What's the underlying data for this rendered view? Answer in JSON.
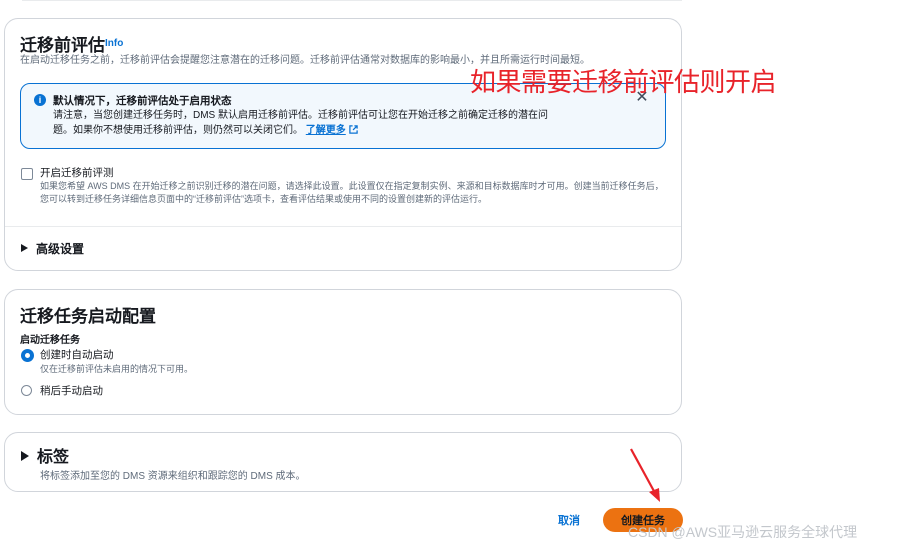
{
  "premigration": {
    "title": "迁移前评估",
    "info_link": "Info",
    "description": "在启动迁移任务之前，迁移前评估会提醒您注意潜在的迁移问题。迁移前评估通常对数据库的影响最小，并且所需运行时间最短。",
    "alert": {
      "title": "默认情况下，迁移前评估处于启用状态",
      "body_line1": "请注意，当您创建迁移任务时，DMS 默认启用迁移前评估。迁移前评估可让您在开始迁移之前确定迁移的潜在问",
      "body_line2": "题。如果你不想使用迁移前评估，则仍然可以关闭它们。",
      "learn_more": "了解更多"
    },
    "checkbox_label": "开启迁移前评测",
    "checkbox_desc": "如果您希望 AWS DMS 在开始迁移之前识别迁移的潜在问题，请选择此设置。此设置仅在指定复制实例、来源和目标数据库时才可用。创建当前迁移任务后，您可以转到迁移任务详细信息页面中的“迁移前评估”选项卡，查看评估结果或使用不同的设置创建新的评估运行。",
    "advanced_label": "高级设置"
  },
  "startup": {
    "title": "迁移任务启动配置",
    "field_label": "启动迁移任务",
    "options": [
      {
        "label": "创建时自动启动",
        "desc": "仅在迁移前评估未启用的情况下可用。",
        "checked": true
      },
      {
        "label": "稍后手动启动",
        "desc": "",
        "checked": false
      }
    ]
  },
  "tags": {
    "title": "标签",
    "description": "将标签添加至您的 DMS 资源来组织和跟踪您的 DMS 成本。"
  },
  "footer": {
    "cancel_label": "取消",
    "create_label": "创建任务"
  },
  "annotation_text": "如果需要迁移前评估则开启",
  "watermark": "CSDN @AWS亚马逊云服务全球代理",
  "colors": {
    "link": "#0972d3",
    "primary_button": "#ec7211",
    "annotation": "#e8232a",
    "alert_bg": "#f2f8fd"
  },
  "icons": [
    "info-icon",
    "close-icon",
    "external-link-icon",
    "caret-right-icon",
    "arrow-icon"
  ]
}
